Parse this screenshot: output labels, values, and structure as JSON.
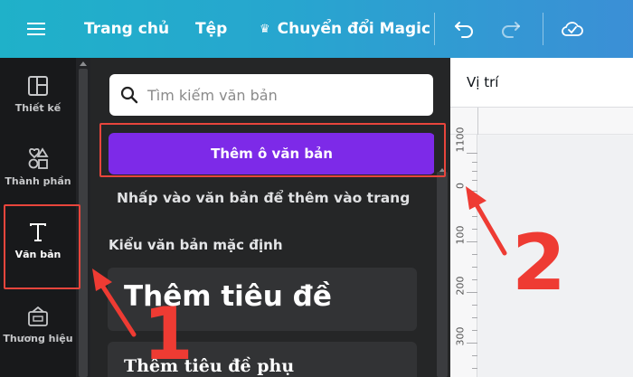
{
  "topbar": {
    "home": "Trang chủ",
    "file": "Tệp",
    "magic_crown": "♛",
    "magic": "Chuyển đổi Magic"
  },
  "rail": {
    "items": [
      {
        "label": "Thiết kế",
        "icon": "layout-icon"
      },
      {
        "label": "Thành phần",
        "icon": "shapes-icon"
      },
      {
        "label": "Văn bản",
        "icon": "text-icon",
        "active": true
      },
      {
        "label": "Thương hiệu",
        "icon": "brand-icon"
      }
    ]
  },
  "panel": {
    "search_placeholder": "Tìm kiếm văn bản",
    "add_text_button": "Thêm ô văn bản",
    "hint": "Nhấp vào văn bản để thêm vào trang",
    "default_styles_heading": "Kiểu văn bản mặc định",
    "heading_style": "Thêm tiêu đề",
    "subheading_style": "Thêm tiêu đề phụ"
  },
  "right": {
    "position_label": "Vị trí",
    "ruler_marks": [
      "1100",
      "0",
      "100",
      "200",
      "300"
    ]
  },
  "annotations": {
    "step1": "1",
    "step2": "2",
    "color": "#e8453c"
  },
  "colors": {
    "topbar_start": "#1fb1c9",
    "topbar_end": "#3b8fd6",
    "accent_purple": "#7d2ae8",
    "panel_bg": "#252627"
  }
}
